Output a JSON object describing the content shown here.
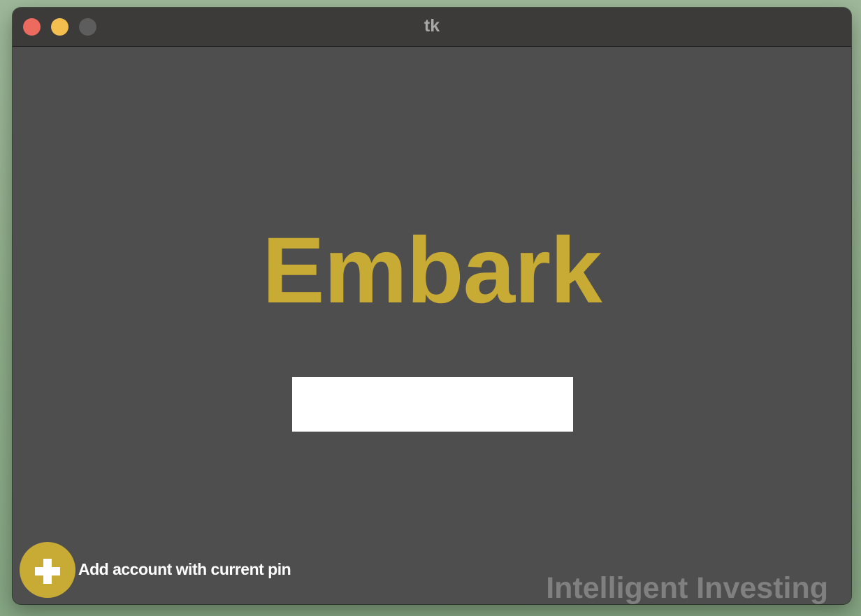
{
  "window": {
    "title": "tk",
    "controls": [
      "close",
      "minimize",
      "zoom"
    ]
  },
  "main": {
    "brand_title": "Embark",
    "pin_input": {
      "value": "",
      "placeholder": ""
    },
    "add_account": {
      "icon": "plus-icon",
      "label": "Add account with current pin"
    },
    "tagline": "Intelligent Investing"
  },
  "colors": {
    "accent": "#c8ab34",
    "background": "#4e4e4e",
    "titlebar": "#3c3b39",
    "tagline": "#808080",
    "close": "#ed6a5e",
    "minimize": "#f5bf4f",
    "zoom": "#5d5d5d"
  }
}
